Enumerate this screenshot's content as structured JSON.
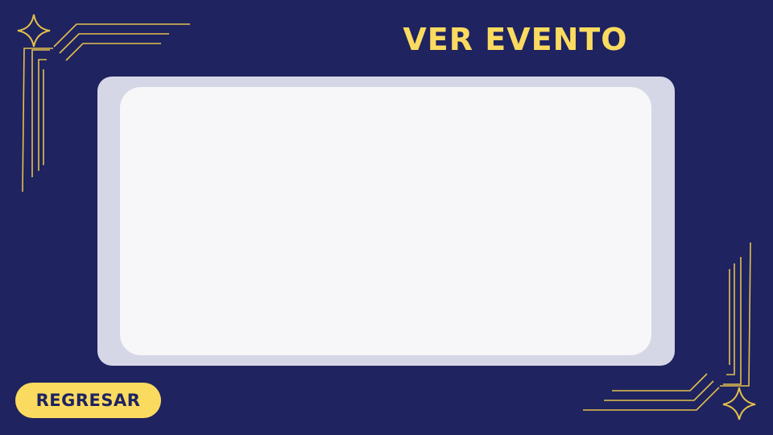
{
  "header": {
    "title": "VER EVENTO"
  },
  "event_panel": {
    "content": ""
  },
  "footer": {
    "back_label": "REGRESAR"
  },
  "colors": {
    "background": "#1f2360",
    "accent": "#fbdb5f",
    "frame_outer": "#d6d7e6",
    "frame_inner": "#f7f7f9",
    "button_text": "#1f2360",
    "ornament_line": "#e3c04c"
  },
  "icons": {
    "corner_star": "four-point-star-icon"
  }
}
